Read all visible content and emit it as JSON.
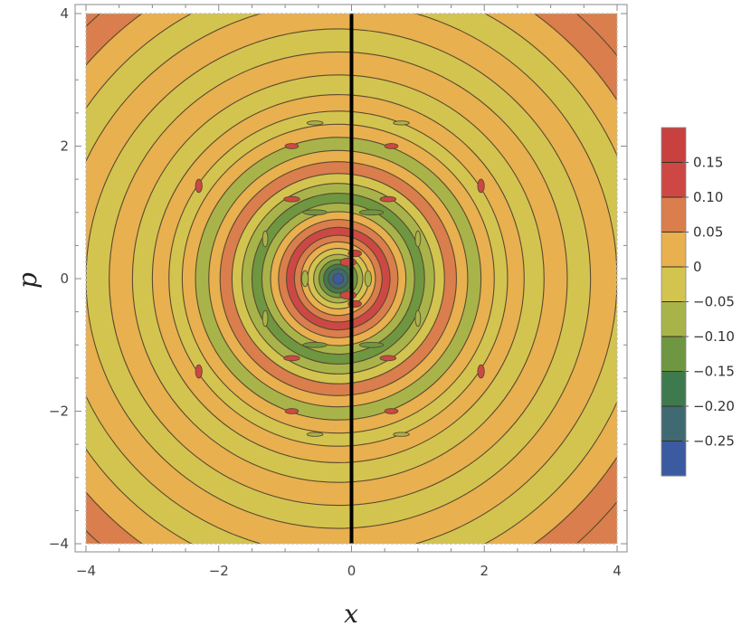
{
  "chart_data": {
    "type": "heatmap",
    "subtype": "filled-contour",
    "title": "",
    "xlabel": "x",
    "ylabel": "p",
    "xlim": [
      -4,
      4
    ],
    "ylim": [
      -4,
      4
    ],
    "x_ticks": [
      {
        "value": -4,
        "label": "−4"
      },
      {
        "value": -2,
        "label": "−2"
      },
      {
        "value": 0,
        "label": "0"
      },
      {
        "value": 2,
        "label": "2"
      },
      {
        "value": 4,
        "label": "4"
      }
    ],
    "y_ticks": [
      {
        "value": -4,
        "label": "−4"
      },
      {
        "value": -2,
        "label": "−2"
      },
      {
        "value": 0,
        "label": "0"
      },
      {
        "value": 2,
        "label": "2"
      },
      {
        "value": 4,
        "label": "4"
      }
    ],
    "vertical_line": {
      "x": 0,
      "color": "#000000"
    },
    "legend": {
      "placement": "right",
      "bands": [
        {
          "color": "#c8413f"
        },
        {
          "color": "#cd4844"
        },
        {
          "color": "#d97e4c"
        },
        {
          "color": "#e8b04e"
        },
        {
          "color": "#d3c450"
        },
        {
          "color": "#a8b44a"
        },
        {
          "color": "#6f9640"
        },
        {
          "color": "#3f7a4f"
        },
        {
          "color": "#3f6a72"
        },
        {
          "color": "#3b5aa0"
        }
      ],
      "labels": [
        {
          "value": 0.15,
          "label": "0.15"
        },
        {
          "value": 0.1,
          "label": "0.10"
        },
        {
          "value": 0.05,
          "label": "0.05"
        },
        {
          "value": 0,
          "label": "0"
        },
        {
          "value": -0.05,
          "label": "−0.05"
        },
        {
          "value": -0.1,
          "label": "−0.10"
        },
        {
          "value": -0.15,
          "label": "−0.15"
        },
        {
          "value": -0.2,
          "label": "−0.20"
        },
        {
          "value": -0.25,
          "label": "−0.25"
        }
      ]
    },
    "contour_rings": [
      {
        "radius": 5.4,
        "color": "#d97e4c"
      },
      {
        "radius": 5.0,
        "color": "#e8b04e"
      },
      {
        "radius": 4.6,
        "color": "#d3c450"
      },
      {
        "radius": 4.2,
        "color": "#e8b04e"
      },
      {
        "radius": 3.8,
        "color": "#d3c450"
      },
      {
        "radius": 3.45,
        "color": "#e8b04e"
      },
      {
        "radius": 3.1,
        "color": "#d3c450"
      },
      {
        "radius": 2.8,
        "color": "#e8b04e"
      },
      {
        "radius": 2.55,
        "color": "#d3c450"
      },
      {
        "radius": 2.35,
        "color": "#e8b04e"
      },
      {
        "radius": 2.15,
        "color": "#a8b44a"
      },
      {
        "radius": 1.95,
        "color": "#e8b04e"
      },
      {
        "radius": 1.78,
        "color": "#d97e4c"
      },
      {
        "radius": 1.6,
        "color": "#d3c450"
      },
      {
        "radius": 1.45,
        "color": "#a8b44a"
      },
      {
        "radius": 1.3,
        "color": "#6f9640"
      },
      {
        "radius": 1.15,
        "color": "#a8b44a"
      },
      {
        "radius": 1.02,
        "color": "#e8b04e"
      },
      {
        "radius": 0.9,
        "color": "#d97e4c"
      },
      {
        "radius": 0.78,
        "color": "#cd4844"
      },
      {
        "radius": 0.66,
        "color": "#d97e4c"
      },
      {
        "radius": 0.56,
        "color": "#e8b04e"
      },
      {
        "radius": 0.46,
        "color": "#d3c450"
      },
      {
        "radius": 0.37,
        "color": "#a8b44a"
      },
      {
        "radius": 0.29,
        "color": "#6f9640"
      },
      {
        "radius": 0.22,
        "color": "#3f7a4f"
      },
      {
        "radius": 0.15,
        "color": "#3f6a72"
      },
      {
        "radius": 0.08,
        "color": "#3b5aa0"
      }
    ],
    "center": {
      "x": -0.2,
      "p": 0.0
    },
    "corner_color": "#d97e4c"
  }
}
